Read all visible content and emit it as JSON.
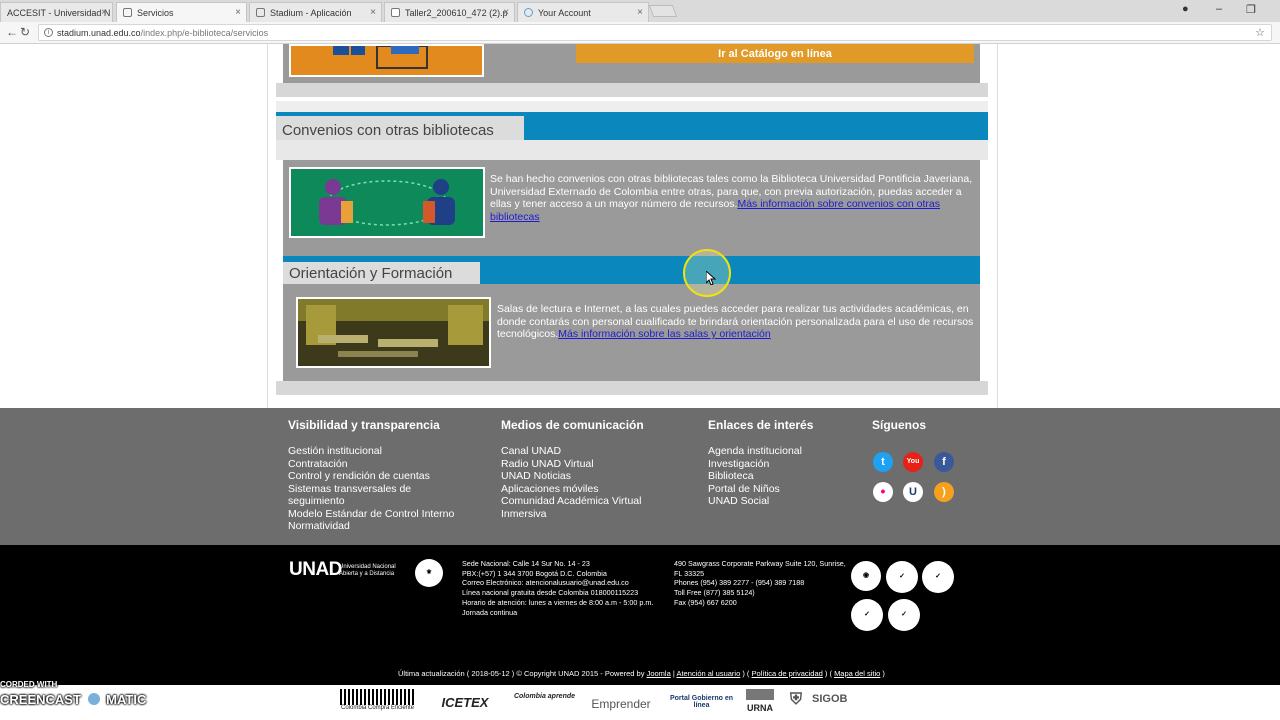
{
  "browser": {
    "tabs": [
      {
        "label": "ACCESIT - Universidad N"
      },
      {
        "label": "Servicios"
      },
      {
        "label": "Stadium - Aplicación"
      },
      {
        "label": "Taller2_200610_472 (2).p"
      },
      {
        "label": "Your Account"
      }
    ],
    "url_host": "stadium.unad.edu.co",
    "url_path": "/index.php/e-biblioteca/servicios"
  },
  "page": {
    "catalog_button": "Ir al Catálogo en línea",
    "convenios": {
      "title": "Convenios con otras bibliotecas",
      "text": "Se han hecho convenios con otras bibliotecas tales como la Biblioteca Universidad Pontificia Javeriana, Universidad Externado de Colombia entre otras, para que, con previa autorización, puedas acceder a ellas y tener acceso a un mayor número de recursos.",
      "link": "Más información sobre convenios con otras bibliotecas"
    },
    "orientacion": {
      "title": "Orientación y Formación",
      "text": "Salas de lectura e Internet, a las cuales puedes acceder para realizar tus actividades académicas,  en donde contarás con personal cualificado te brindará orientación personalizada para el uso de recursos tecnológicos.",
      "link": "Más información sobre las salas y orientación"
    }
  },
  "footer": {
    "col1": {
      "title": "Visibilidad y transparencia",
      "links": [
        "Gestión institucional",
        "Contratación",
        "Control y rendición de cuentas",
        "Sistemas transversales de",
        "seguimiento",
        "Modelo Estándar de Control Interno",
        "Normatividad"
      ]
    },
    "col2": {
      "title": "Medios de comunicación",
      "links": [
        "Canal UNAD",
        "Radio UNAD Virtual",
        "UNAD Noticias",
        "Aplicaciones móviles",
        "Comunidad Académica Virtual",
        "Inmersiva"
      ]
    },
    "col3": {
      "title": "Enlaces de interés",
      "links": [
        "Agenda institucional",
        "Investigación",
        "Biblioteca",
        "Portal de Niños",
        "UNAD Social"
      ]
    },
    "col4": {
      "title": "Síguenos",
      "icons": [
        "twitter-icon",
        "youtube-icon",
        "facebook-icon",
        "flickr-icon",
        "unad-icon",
        "rss-icon"
      ],
      "colors": {
        "twitter": "#1da1f2",
        "youtube": "#e62117",
        "facebook": "#3b5998",
        "flickr": "#ffffff",
        "unad": "#ffffff",
        "rss": "#f7a01d"
      }
    },
    "unad_logo": "UNAD",
    "unad_logo_sub": [
      "Universidad Nacional",
      "Abierta y a Distancia"
    ],
    "contact_lines": [
      "Sede Nacional: Calle 14 Sur No. 14 - 23",
      "PBX:(+57) 1 344 3700 Bogotá D.C. Colombia",
      "Correo Electrónico: atencionalusuario@unad.edu.co",
      "Línea nacional gratuita desde Colombia 018000115223",
      "Horario de atención: lunes a viernes de 8:00 a.m - 5:00 p.m.",
      "Jornada continua"
    ],
    "us_lines": [
      "490 Sawgrass Corporate Parkway Suite 120, Sunrise,",
      "FL 33325",
      "Phones (954) 389 2277 - (954) 389 7188",
      "Toll Free (877) 385 5124)",
      "Fax (954) 667 6200"
    ],
    "bottom_prefix": "Última actualización ( 2018-05-12 ) © Copyright UNAD 2015  - Powered by",
    "bottom_links": [
      "Joomla",
      "Atención al usuario",
      "Política de privacidad",
      "Mapa del sitio"
    ],
    "partner_logos": [
      "Colombia Compra Eficiente",
      "ICETEX",
      "Colombia aprende",
      "Emprender",
      "Portal Gobierno en línea",
      "URNA",
      "SIGOB"
    ]
  },
  "watermark": {
    "text1": "CORDED WITH",
    "text2": "CREENCAST",
    "text3": "MATIC"
  }
}
